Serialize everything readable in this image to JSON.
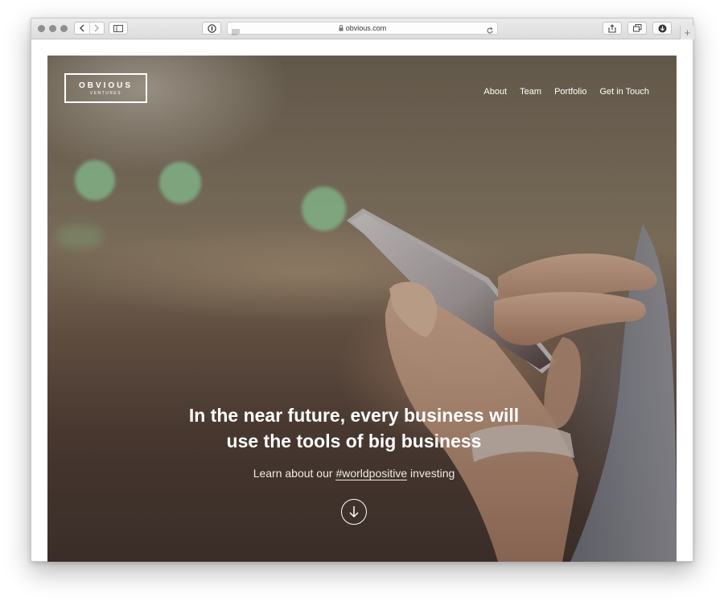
{
  "browser": {
    "url": "obvious.com",
    "new_tab_label": "+"
  },
  "site": {
    "logo_word": "OBVIOUS",
    "logo_sub": "VENTURES",
    "nav": [
      "About",
      "Team",
      "Portfolio",
      "Get in Touch"
    ]
  },
  "hero": {
    "headline_line1": "In the near future, every business will",
    "headline_line2": "use the tools of big business",
    "sub_prefix": "Learn about our",
    "sub_tag": "#worldpositive",
    "sub_suffix": "investing"
  },
  "icons": [
    "back-icon",
    "forward-icon",
    "sidebar-icon",
    "info-icon",
    "reader-icon",
    "lock-icon",
    "reload-icon",
    "share-icon",
    "tabs-icon",
    "download-icon",
    "arrow-down-icon"
  ],
  "colors": {
    "hero_overlay": "#5b4a3f",
    "bokeh": "#8fdfa8",
    "text": "#ffffff"
  }
}
